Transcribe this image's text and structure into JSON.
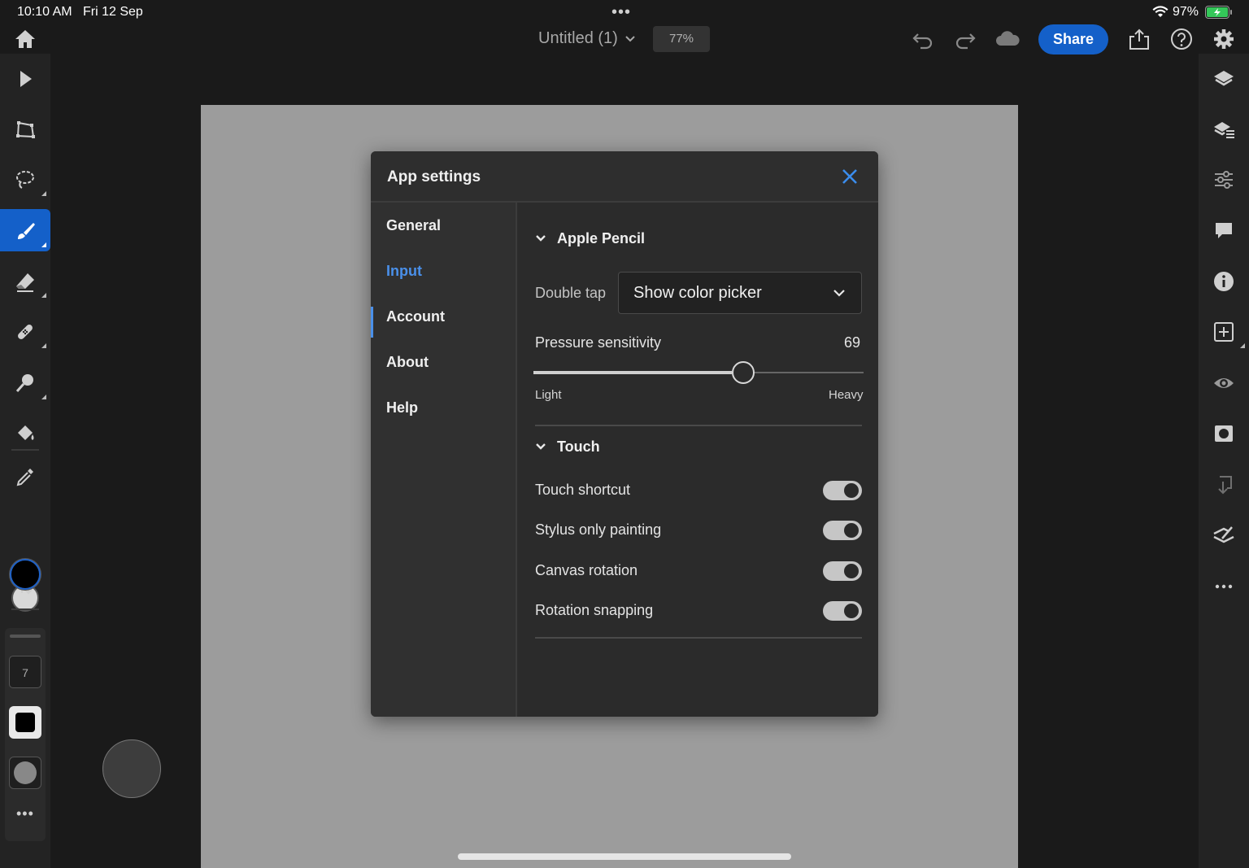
{
  "status_bar": {
    "time": "10:10 AM",
    "date": "Fri 12 Sep",
    "dots": "•••",
    "battery_percent": "97%"
  },
  "top_bar": {
    "document_title": "Untitled (1)",
    "zoom": "77%",
    "share_label": "Share",
    "icons": [
      "home-icon",
      "undo-icon",
      "redo-icon",
      "cloud-icon",
      "export-icon",
      "help-icon",
      "gear-icon"
    ]
  },
  "left_toolbar": {
    "tools": [
      "select-icon",
      "transform-icon",
      "lasso-icon",
      "brush-icon",
      "eraser-icon",
      "healing-icon",
      "smudge-icon",
      "fill-icon",
      "eyedropper-icon",
      "swap-colors-icon"
    ],
    "active_tool": "brush",
    "brush_size": "7",
    "primary_color": "#000000",
    "secondary_color": "#d8d8d8",
    "more_label": "•••"
  },
  "right_toolbar": {
    "tools": [
      "layers-icon",
      "layer-stack-icon",
      "adjustments-icon",
      "comments-icon",
      "info-icon",
      "add-layer-icon",
      "visibility-icon",
      "mask-icon",
      "merge-down-icon",
      "clear-icon",
      "more-icon"
    ]
  },
  "dialog": {
    "title": "App settings",
    "nav": [
      {
        "label": "General"
      },
      {
        "label": "Input"
      },
      {
        "label": "Account"
      },
      {
        "label": "About"
      },
      {
        "label": "Help"
      }
    ],
    "active_nav": "Input",
    "apple_pencil": {
      "heading": "Apple Pencil",
      "double_tap_label": "Double tap",
      "double_tap_value": "Show color picker",
      "pressure_label": "Pressure sensitivity",
      "pressure_value": "69",
      "pressure_fraction": 0.69,
      "min_label": "Light",
      "max_label": "Heavy"
    },
    "touch": {
      "heading": "Touch",
      "toggles": [
        {
          "label": "Touch shortcut",
          "on": true
        },
        {
          "label": "Stylus only painting",
          "on": true
        },
        {
          "label": "Canvas rotation",
          "on": true
        },
        {
          "label": "Rotation snapping",
          "on": true
        }
      ]
    }
  },
  "colors": {
    "accent": "#1460c9",
    "link_active": "#4a90ea",
    "canvas": "#9c9c9c"
  }
}
